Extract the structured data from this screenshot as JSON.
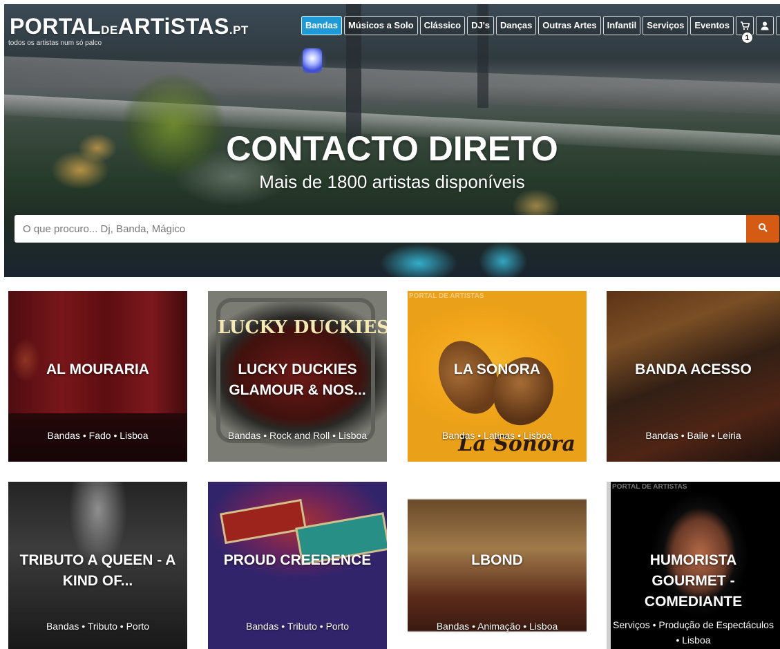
{
  "header": {
    "logo_main": "PORTAL",
    "logo_de": "DE",
    "logo_rest": "ARTiSTAS",
    "logo_tld": ".PT",
    "tagline": "todos os artistas num só palco"
  },
  "nav": {
    "items": [
      {
        "label": "Bandas",
        "active": true
      },
      {
        "label": "Músicos a Solo"
      },
      {
        "label": "Clássico"
      },
      {
        "label": "DJ's"
      },
      {
        "label": "Danças"
      },
      {
        "label": "Outras Artes"
      },
      {
        "label": "Infantil"
      },
      {
        "label": "Serviços"
      },
      {
        "label": "Eventos"
      }
    ],
    "cart_icon": "cart-icon",
    "cart_count": "1",
    "user_icon": "user-icon",
    "search_icon": "search-icon"
  },
  "hero": {
    "title": "CONTACTO DIRETO",
    "subtitle": "Mais de 1800 artistas disponíveis"
  },
  "search": {
    "placeholder": "O que procuro... Dj, Banda, Mágico",
    "button_icon": "search-icon"
  },
  "colors": {
    "nav_active": "#1f9ad6",
    "search_button": "#d55a14"
  },
  "cards": [
    {
      "title": "AL MOURARIA",
      "tags": "Bandas • Fado • Lisboa"
    },
    {
      "title": "LUCKY DUCKIES GLAMOUR & NOS...",
      "tags": "Bandas • Rock and Roll • Lisboa"
    },
    {
      "title": "LA SONORA",
      "tags": "Bandas • Latinas • Lisboa"
    },
    {
      "title": "BANDA ACESSO",
      "tags": "Bandas • Baile • Leiria"
    },
    {
      "title": "TRIBUTO A QUEEN - A KIND OF...",
      "tags": "Bandas • Tributo • Porto"
    },
    {
      "title": "PROUD CREEDENCE",
      "tags": "Bandas • Tributo • Porto"
    },
    {
      "title": "LBOND",
      "tags": "Bandas • Animação • Lisboa"
    },
    {
      "title": "HUMORISTA GOURMET - COMEDIANTE",
      "tags": "Serviços • Produção de Espectáculos • Lisboa"
    }
  ],
  "card_images": {
    "lucky_banner": "LUCKY DUCKIES",
    "la_sonora_script": "La Sonora",
    "watermark": "PORTAL DE ARTISTAS"
  }
}
